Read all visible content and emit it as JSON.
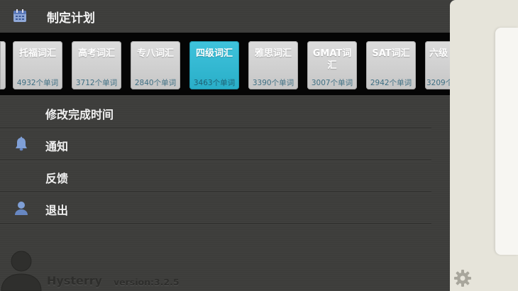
{
  "header": {
    "title": "制定计划",
    "icon": "calendar-icon"
  },
  "books": [
    {
      "name": "托福词汇",
      "count": "4932个单词",
      "selected": false
    },
    {
      "name": "高考词汇",
      "count": "3712个单词",
      "selected": false
    },
    {
      "name": "专八词汇",
      "count": "2840个单词",
      "selected": false
    },
    {
      "name": "四级词汇",
      "count": "3463个单词",
      "selected": true
    },
    {
      "name": "雅思词汇",
      "count": "3390个单词",
      "selected": false
    },
    {
      "name": "GMAT词汇",
      "count": "3007个单词",
      "selected": false
    },
    {
      "name": "SAT词汇",
      "count": "2942个单词",
      "selected": false
    },
    {
      "name": "六级",
      "count": "3209个",
      "selected": false
    }
  ],
  "menu": {
    "items": [
      {
        "label": "修改完成时间",
        "icon": ""
      },
      {
        "label": "通知",
        "icon": "bell-icon"
      },
      {
        "label": "反馈",
        "icon": ""
      },
      {
        "label": "退出",
        "icon": "user-icon"
      }
    ]
  },
  "footer": {
    "username": "Hysterry",
    "version": "version:3.2.5"
  },
  "colors": {
    "accent": "#2db4cd",
    "book_bg": "#d3d3d3",
    "panel": "#e6e4da"
  }
}
